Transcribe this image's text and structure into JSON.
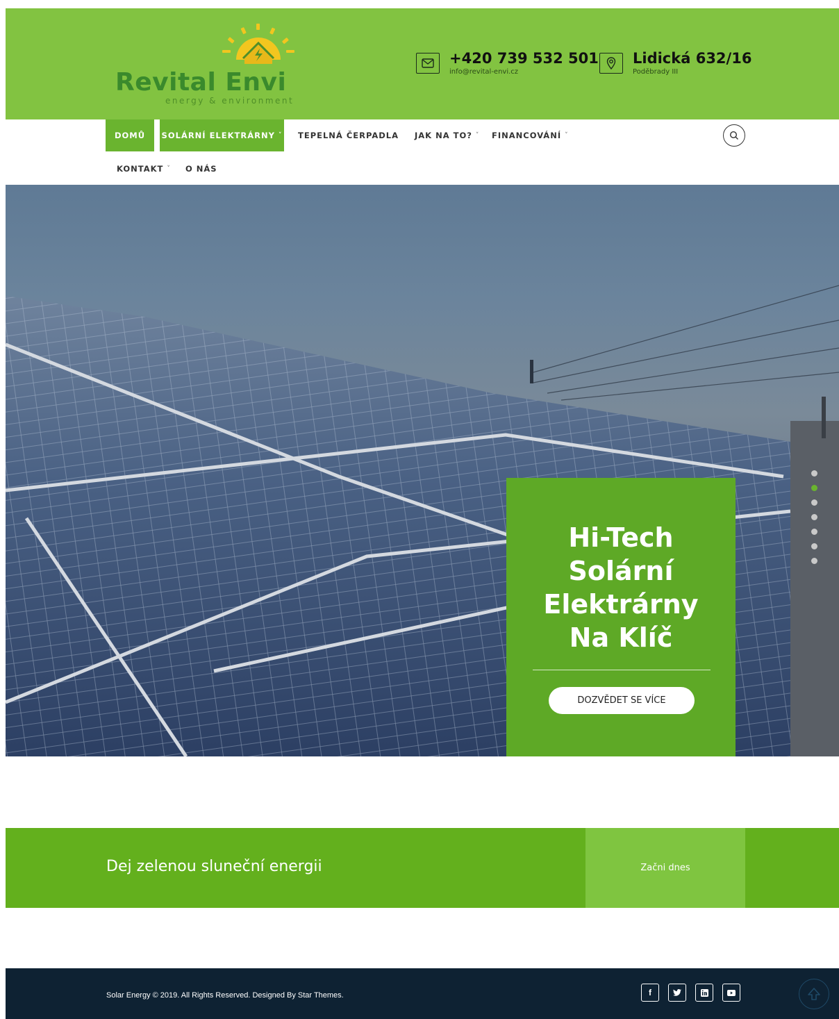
{
  "brand": {
    "name": "Revital Envi",
    "tagline": "energy & environment",
    "primary_color": "#82c341",
    "accent_color": "#5ea926",
    "logo_icon": "sun-house-icon"
  },
  "header": {
    "phone": "+420 739 532 501",
    "email": "info@revital-envi.cz",
    "email_icon": "envelope-icon",
    "address": "Lidická 632/16",
    "city": "Poděbrady III",
    "address_icon": "location-pin-icon"
  },
  "nav": {
    "items": [
      {
        "label": "DOMŮ",
        "active": true
      },
      {
        "label": "SOLÁRNÍ ELEKTRÁRNY",
        "active": true,
        "dropdown": true
      },
      {
        "label": "TEPELNÁ ČERPADLA"
      },
      {
        "label": "JAK NA TO?",
        "dropdown": true
      },
      {
        "label": "FINANCOVÁNÍ",
        "dropdown": true
      },
      {
        "label": "KONTAKT",
        "dropdown": true
      },
      {
        "label": "O NÁS"
      }
    ],
    "chevron": "˅",
    "search_icon": "search-icon"
  },
  "hero": {
    "title": "Hi-Tech\nSolární\nElektrárny\nNa Klíč",
    "button": "DOZVĚDET SE VÍCE",
    "slides": 7,
    "active_slide": 2
  },
  "cta": {
    "text": "Dej zelenou sluneční energii",
    "button": "Začni dnes"
  },
  "footer": {
    "copyright": "Solar Energy © 2019. All Rights Reserved. Designed By Star Themes.",
    "social": [
      {
        "glyph": "f",
        "icon": "facebook-icon"
      },
      {
        "glyph": "🐦",
        "icon": "twitter-icon"
      },
      {
        "glyph": "in",
        "icon": "linkedin-icon"
      },
      {
        "glyph": "▶",
        "icon": "youtube-icon"
      }
    ],
    "scroll_top_icon": "arrow-up-icon"
  }
}
